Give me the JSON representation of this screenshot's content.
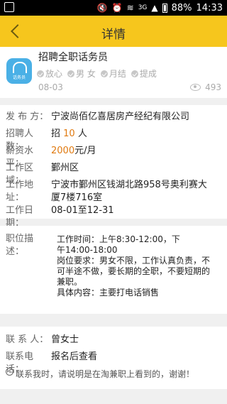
{
  "status_bar": {
    "network": "3G",
    "battery": "88%",
    "time": "14:33"
  },
  "header": {
    "title": "详情"
  },
  "job": {
    "title": "招聘全职话务员",
    "avatar_label": "话务员",
    "tags": [
      "放心",
      "男 女",
      "月结",
      "提成"
    ],
    "date": "08-03",
    "views": "493"
  },
  "details": {
    "publisher_label": "发 布 方：",
    "publisher": "宁波尚佰亿喜居房产经纪有限公司",
    "headcount_label": "招聘人数：",
    "headcount_prefix": "招",
    "headcount_value": "10",
    "headcount_unit": "人",
    "salary_label": "薪资水平：",
    "salary_value": "2000",
    "salary_unit": "元/月",
    "area_label": "工作区域：",
    "area": "鄞州区",
    "address_label": "工作地址：",
    "address_line1": "宁波市鄞州区钱湖北路958号奥利赛大",
    "address_line2": "厦7楼716室",
    "dates_label": "工作日期：",
    "dates": "08-01至12-31"
  },
  "description": {
    "label": "职位描述：",
    "lines": [
      "工作时间：上午8:30-12:00，下",
      "午14:00-18:00",
      "岗位要求：男女不限，工作认真负责，不",
      "可半途不做，要长期的全职，不要短期的",
      "兼职。",
      "具体内容：主要打电话销售"
    ]
  },
  "contact": {
    "person_label": "联 系 人：",
    "person": "曾女士",
    "phone_label": "联系电话：",
    "phone": "报名后查看",
    "note": "联系我时，请说明是在淘兼职上看到的，谢谢！"
  }
}
